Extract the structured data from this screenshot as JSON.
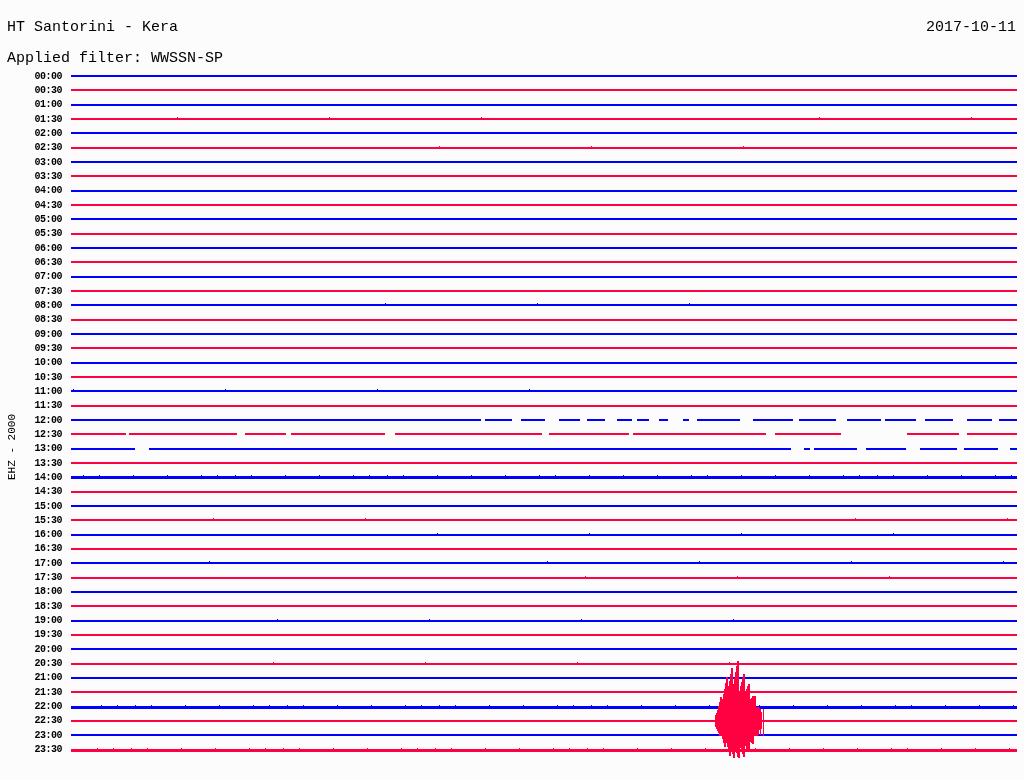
{
  "header": {
    "title": "HT Santorini - Kera",
    "date": "2017-10-11",
    "filter": "Applied filter: WWSSN-SP"
  },
  "axis_label": "EHZ - 2000",
  "traces": [
    {
      "label": "00:00",
      "color": "#0000ff",
      "kind": "flat"
    },
    {
      "label": "00:30",
      "color": "#ff0040",
      "kind": "flat"
    },
    {
      "label": "01:00",
      "color": "#0000ff",
      "kind": "flat"
    },
    {
      "label": "01:30",
      "color": "#ff0040",
      "kind": "spiky"
    },
    {
      "label": "02:00",
      "color": "#0000ff",
      "kind": "flat"
    },
    {
      "label": "02:30",
      "color": "#ff0040",
      "kind": "spiky"
    },
    {
      "label": "03:00",
      "color": "#0000ff",
      "kind": "flat"
    },
    {
      "label": "03:30",
      "color": "#ff0040",
      "kind": "flat"
    },
    {
      "label": "04:00",
      "color": "#0000ff",
      "kind": "flat"
    },
    {
      "label": "04:30",
      "color": "#ff0040",
      "kind": "flat"
    },
    {
      "label": "05:00",
      "color": "#0000ff",
      "kind": "flat"
    },
    {
      "label": "05:30",
      "color": "#ff0040",
      "kind": "flat"
    },
    {
      "label": "06:00",
      "color": "#0000ff",
      "kind": "flat"
    },
    {
      "label": "06:30",
      "color": "#ff0040",
      "kind": "flat"
    },
    {
      "label": "07:00",
      "color": "#0000ff",
      "kind": "flat"
    },
    {
      "label": "07:30",
      "color": "#ff0040",
      "kind": "flat"
    },
    {
      "label": "08:00",
      "color": "#0000ff",
      "kind": "spiky"
    },
    {
      "label": "08:30",
      "color": "#ff0040",
      "kind": "flat"
    },
    {
      "label": "09:00",
      "color": "#0000ff",
      "kind": "flat"
    },
    {
      "label": "09:30",
      "color": "#ff0040",
      "kind": "flat"
    },
    {
      "label": "10:00",
      "color": "#0000ff",
      "kind": "flat"
    },
    {
      "label": "10:30",
      "color": "#ff0040",
      "kind": "flat"
    },
    {
      "label": "11:00",
      "color": "#0000ff",
      "kind": "spiky"
    },
    {
      "label": "11:30",
      "color": "#ff0040",
      "kind": "flat"
    },
    {
      "label": "12:00",
      "color": "#0000ff",
      "kind": "gappy"
    },
    {
      "label": "12:30",
      "color": "#ff0040",
      "kind": "gappy"
    },
    {
      "label": "13:00",
      "color": "#0000ff",
      "kind": "gappy"
    },
    {
      "label": "13:30",
      "color": "#ff0040",
      "kind": "flat"
    },
    {
      "label": "14:00",
      "color": "#0000ff",
      "kind": "dense"
    },
    {
      "label": "14:30",
      "color": "#ff0040",
      "kind": "flat"
    },
    {
      "label": "15:00",
      "color": "#0000ff",
      "kind": "flat"
    },
    {
      "label": "15:30",
      "color": "#ff0040",
      "kind": "spiky"
    },
    {
      "label": "16:00",
      "color": "#0000ff",
      "kind": "spiky"
    },
    {
      "label": "16:30",
      "color": "#ff0040",
      "kind": "flat"
    },
    {
      "label": "17:00",
      "color": "#0000ff",
      "kind": "spiky"
    },
    {
      "label": "17:30",
      "color": "#ff0040",
      "kind": "spiky"
    },
    {
      "label": "18:00",
      "color": "#0000ff",
      "kind": "flat"
    },
    {
      "label": "18:30",
      "color": "#ff0040",
      "kind": "flat"
    },
    {
      "label": "19:00",
      "color": "#0000ff",
      "kind": "spiky"
    },
    {
      "label": "19:30",
      "color": "#ff0040",
      "kind": "flat"
    },
    {
      "label": "20:00",
      "color": "#0000ff",
      "kind": "flat"
    },
    {
      "label": "20:30",
      "color": "#ff0040",
      "kind": "spiky"
    },
    {
      "label": "21:00",
      "color": "#0000ff",
      "kind": "flat"
    },
    {
      "label": "21:30",
      "color": "#ff0040",
      "kind": "flat"
    },
    {
      "label": "22:00",
      "color": "#0000ff",
      "kind": "dense"
    },
    {
      "label": "22:30",
      "color": "#ff0040",
      "kind": "event"
    },
    {
      "label": "23:00",
      "color": "#0000ff",
      "kind": "flat"
    },
    {
      "label": "23:30",
      "color": "#ff0040",
      "kind": "dense"
    }
  ]
}
